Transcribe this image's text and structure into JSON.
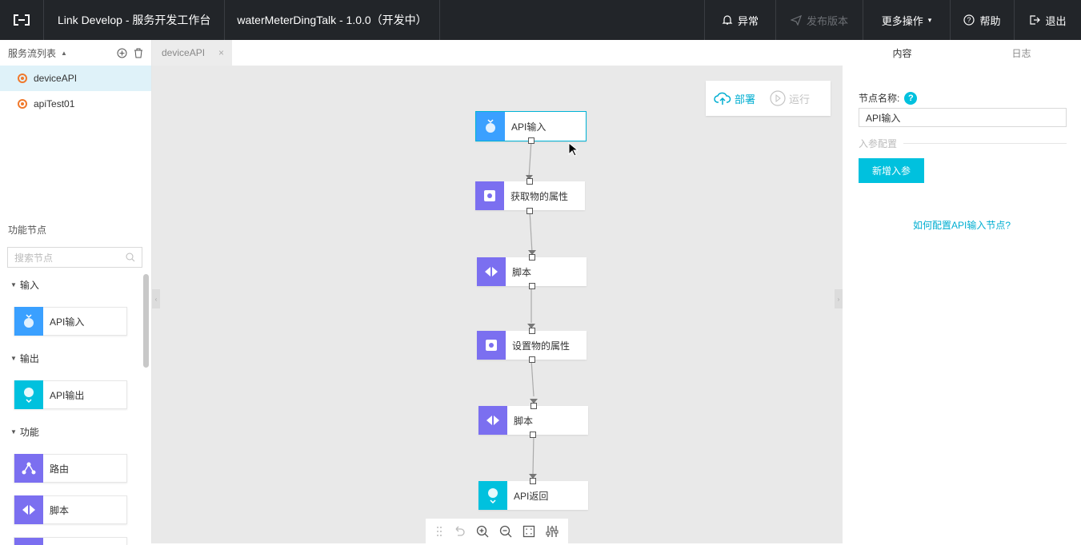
{
  "header": {
    "app_title": "Link Develop - 服务开发工作台",
    "project": "waterMeterDingTalk - 1.0.0（开发中）",
    "buttons": {
      "alarm": "异常",
      "publish": "发布版本",
      "more": "更多操作",
      "help": "帮助",
      "exit": "退出"
    }
  },
  "sidebar": {
    "flow_list_title": "服务流列表",
    "flows": [
      {
        "name": "deviceAPI",
        "active": true
      },
      {
        "name": "apiTest01",
        "active": false
      }
    ],
    "nodes_title": "功能节点",
    "search_placeholder": "搜索节点",
    "sections": [
      {
        "title": "输入",
        "items": [
          "API输入"
        ]
      },
      {
        "title": "输出",
        "items": [
          "API输出"
        ]
      },
      {
        "title": "功能",
        "items": [
          "路由",
          "脚本"
        ]
      }
    ]
  },
  "tabs": [
    {
      "label": "deviceAPI",
      "close": "×"
    }
  ],
  "canvas": {
    "deploy_label": "部署",
    "run_label": "运行",
    "nodes": [
      {
        "label": "API输入",
        "kind": "api-input",
        "color": "#3aa0ff"
      },
      {
        "label": "获取物的属性",
        "kind": "thing",
        "color": "#7b6ff0"
      },
      {
        "label": "脚本",
        "kind": "script",
        "color": "#7b6ff0"
      },
      {
        "label": "设置物的属性",
        "kind": "thing",
        "color": "#7b6ff0"
      },
      {
        "label": "脚本",
        "kind": "script",
        "color": "#7b6ff0"
      },
      {
        "label": "API返回",
        "kind": "api-output",
        "color": "#00c1de"
      }
    ]
  },
  "panel": {
    "tabs": [
      "内容",
      "日志"
    ],
    "node_name_label": "节点名称:",
    "help_glyph": "?",
    "node_name_value": "API输入",
    "params_section": "入参配置",
    "add_param_button": "新增入参",
    "help_link": "如何配置API输入节点?"
  },
  "colors": {
    "accent": "#00c1de",
    "topbar": "#222529",
    "flow_dot": "#f0792c"
  }
}
